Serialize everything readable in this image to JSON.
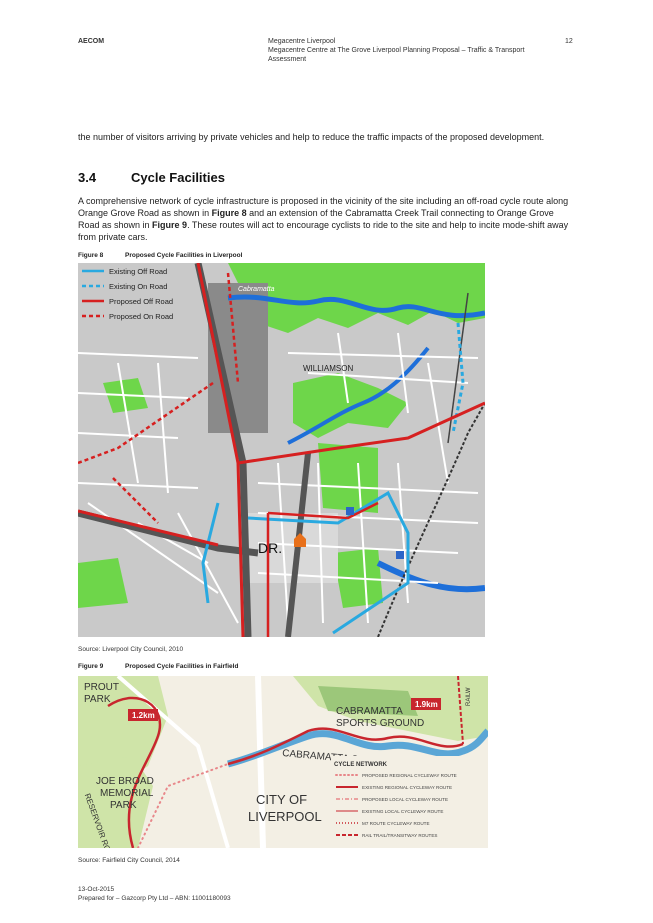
{
  "header": {
    "company": "AECOM",
    "client": "Megacentre Liverpool",
    "project": "Megacentre Centre at The Grove Liverpool Planning Proposal – Traffic & Transport Assessment",
    "page_number": "12"
  },
  "intro_text": "the number of visitors arriving by private vehicles and help to reduce the traffic impacts of the proposed development.",
  "section": {
    "number": "3.4",
    "title": "Cycle Facilities",
    "body_a": "A comprehensive network of cycle infrastructure is proposed in the vicinity of the site including an off-road cycle route along Orange Grove Road as shown in ",
    "fig8_ref": "Figure 8",
    "body_b": " and an extension of the Cabramatta Creek Trail connecting to Orange Grove Road as shown in ",
    "fig9_ref": "Figure 9",
    "body_c": ". These routes will act to encourage cyclists to ride to the site and help to incite mode-shift away from private cars."
  },
  "figure8": {
    "label": "Figure 8",
    "title": "Proposed Cycle Facilities in Liverpool",
    "legend": [
      {
        "label": "Existing Off Road",
        "color": "#29a9e0",
        "dash": false
      },
      {
        "label": "Existing On Road",
        "color": "#29a9e0",
        "dash": true
      },
      {
        "label": "Proposed Off Road",
        "color": "#d62020",
        "dash": false
      },
      {
        "label": "Proposed On Road",
        "color": "#d62020",
        "dash": true
      }
    ],
    "map_labels": {
      "creek": "Cabramatta",
      "suburb": "WILLIAMSON",
      "site": "DR."
    },
    "source": "Source: Liverpool City Council, 2010"
  },
  "figure9": {
    "label": "Figure 9",
    "title": "Proposed Cycle Facilities in Fairfield",
    "map_labels": {
      "prout": [
        "PROUT",
        "PARK"
      ],
      "dist1": "1.2km",
      "dist2": "1.9km",
      "sports": [
        "CABRAMATTA",
        "SPORTS GROUND"
      ],
      "creek": "CABRAMATTA C",
      "joe": [
        "JOE BROAD",
        "MEMORIAL",
        "PARK"
      ],
      "reservoir": "RESERVOIR ROAD",
      "city": [
        "CITY OF",
        "LIVERPOOL"
      ],
      "rail": "RAILW"
    },
    "network_title": "CYCLE NETWORK",
    "network_legend": [
      {
        "label": "PROPOSED REGIONAL CYCLEWAY ROUTE",
        "color": "#e8878a",
        "style": "dots"
      },
      {
        "label": "EXISTING REGIONAL CYCLEWAY ROUTE",
        "color": "#c8262e",
        "style": "solid"
      },
      {
        "label": "PROPOSED LOCAL CYCLEWAY ROUTE",
        "color": "#e8878a",
        "style": "dashdot"
      },
      {
        "label": "EXISTING LOCAL CYCLEWAY ROUTE",
        "color": "#c8262e",
        "style": "thin"
      },
      {
        "label": "M7 ROUTE CYCLEWAY ROUTE",
        "color": "#c8262e",
        "style": "dotted"
      },
      {
        "label": "RAIL TRAIL/TRANSITWAY ROUTES",
        "color": "#c8262e",
        "style": "dash"
      }
    ],
    "source": "Source: Fairfield City Council, 2014"
  },
  "footer": {
    "date": "13-Oct-2015",
    "prepared_for": "Prepared for – Gazcorp Pty Ltd – ABN: 11001180093"
  }
}
